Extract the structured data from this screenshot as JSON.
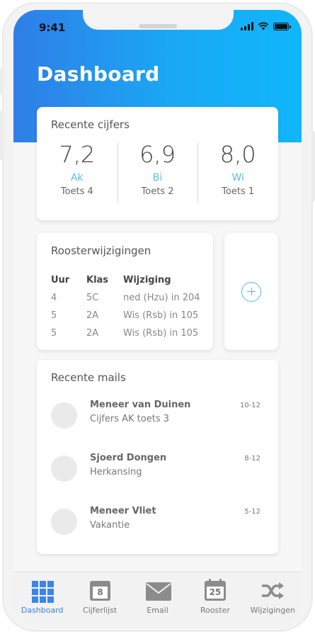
{
  "status_bar": {
    "time": "9:41"
  },
  "header": {
    "title": "Dashboard"
  },
  "grades": {
    "title": "Recente cijfers",
    "items": [
      {
        "value": "7,2",
        "subject": "Ak",
        "test": "Toets 4"
      },
      {
        "value": "6,9",
        "subject": "Bi",
        "test": "Toets 2"
      },
      {
        "value": "8,0",
        "subject": "Wi",
        "test": "Toets 1"
      }
    ]
  },
  "rooster": {
    "title": "Roosterwijzigingen",
    "columns": [
      "Uur",
      "Klas",
      "Wijziging"
    ],
    "rows": [
      [
        "4",
        "5C",
        "ned (Hzu) in 204"
      ],
      [
        "5",
        "2A",
        "Wis (Rsb) in 105"
      ],
      [
        "5",
        "2A",
        "Wis (Rsb) in 105"
      ]
    ]
  },
  "mails": {
    "title": "Recente mails",
    "items": [
      {
        "sender": "Meneer van Duinen",
        "subject": "Cijfers AK toets 3",
        "date": "10-12"
      },
      {
        "sender": "Sjoerd Dongen",
        "subject": "Herkansing",
        "date": "8-12"
      },
      {
        "sender": "Meneer Vliet",
        "subject": "Vakantie",
        "date": "5-12"
      }
    ]
  },
  "tabs": [
    {
      "label": "Dashboard",
      "icon": "grid-icon",
      "active": true
    },
    {
      "label": "Cijferlijst",
      "icon": "calendar-icon",
      "badge": "8"
    },
    {
      "label": "Email",
      "icon": "mail-icon"
    },
    {
      "label": "Rooster",
      "icon": "calendar-icon",
      "badge": "25"
    },
    {
      "label": "Wijzigingen",
      "icon": "shuffle-icon"
    }
  ],
  "colors": {
    "header_gradient_start": "#2f7ee6",
    "header_gradient_end": "#10b6fb",
    "accent": "#5bbbec",
    "active_tab": "#3a86e6"
  }
}
